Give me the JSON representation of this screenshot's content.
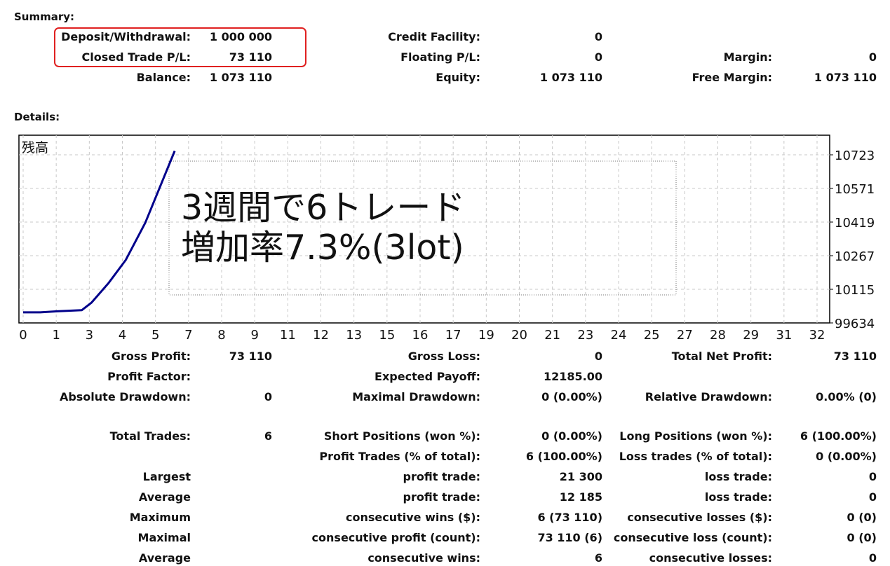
{
  "summary": {
    "heading": "Summary:",
    "deposit_label": "Deposit/Withdrawal:",
    "deposit_value": "1 000 000",
    "closed_pl_label": "Closed Trade P/L:",
    "closed_pl_value": "73 110",
    "balance_label": "Balance:",
    "balance_value": "1 073 110",
    "credit_label": "Credit Facility:",
    "credit_value": "0",
    "floating_label": "Floating P/L:",
    "floating_value": "0",
    "equity_label": "Equity:",
    "equity_value": "1 073 110",
    "margin_label": "Margin:",
    "margin_value": "0",
    "free_margin_label": "Free Margin:",
    "free_margin_value": "1 073 110"
  },
  "details": {
    "heading": "Details:"
  },
  "chart_data": {
    "type": "line",
    "title": "残高",
    "x": [
      0,
      0.7,
      1.4,
      2.4,
      2.8,
      3.5,
      4.2,
      5.0,
      6.2
    ],
    "y": [
      9970,
      9970,
      9975,
      9980,
      10015,
      10105,
      10210,
      10380,
      10708
    ],
    "x_ticks": [
      "0",
      "1",
      "3",
      "4",
      "5",
      "7",
      "8",
      "9",
      "11",
      "12",
      "13",
      "15",
      "16",
      "17",
      "19",
      "20",
      "21",
      "23",
      "24",
      "25",
      "27",
      "28",
      "29",
      "31",
      "32"
    ],
    "y_ticks": [
      "10723",
      "10571",
      "10419",
      "10267",
      "10115",
      "99634"
    ],
    "ylim": [
      9963.4,
      10780
    ],
    "xlim": [
      0,
      33
    ],
    "grid": true,
    "line_color": "#00008b",
    "annotation_line1": "3週間で6トレード",
    "annotation_line2": "増加率7.3%(3lot)"
  },
  "stats": {
    "gross_profit_label": "Gross Profit:",
    "gross_profit_value": "73 110",
    "gross_loss_label": "Gross Loss:",
    "gross_loss_value": "0",
    "total_net_label": "Total Net Profit:",
    "total_net_value": "73 110",
    "profit_factor_label": "Profit Factor:",
    "profit_factor_value": "",
    "expected_payoff_label": "Expected Payoff:",
    "expected_payoff_value": "12185.00",
    "abs_dd_label": "Absolute Drawdown:",
    "abs_dd_value": "0",
    "max_dd_label": "Maximal Drawdown:",
    "max_dd_value": "0 (0.00%)",
    "rel_dd_label": "Relative Drawdown:",
    "rel_dd_value": "0.00% (0)",
    "total_trades_label": "Total Trades:",
    "total_trades_value": "6",
    "short_pos_label": "Short Positions (won %):",
    "short_pos_value": "0 (0.00%)",
    "long_pos_label": "Long Positions (won %):",
    "long_pos_value": "6 (100.00%)",
    "profit_trades_label": "Profit Trades (% of total):",
    "profit_trades_value": "6 (100.00%)",
    "loss_trades_label": "Loss trades (% of total):",
    "loss_trades_value": "0 (0.00%)",
    "largest_label": "Largest",
    "largest_profit_label": "profit trade:",
    "largest_profit_value": "21 300",
    "largest_loss_label": "loss trade:",
    "largest_loss_value": "0",
    "average_label": "Average",
    "average_profit_label": "profit trade:",
    "average_profit_value": "12 185",
    "average_loss_label": "loss trade:",
    "average_loss_value": "0",
    "maximum_label": "Maximum",
    "max_cons_wins_label": "consecutive wins ($):",
    "max_cons_wins_value": "6 (73 110)",
    "max_cons_losses_label": "consecutive losses ($):",
    "max_cons_losses_value": "0 (0)",
    "maximal_label": "Maximal",
    "maximal_cons_profit_label": "consecutive profit (count):",
    "maximal_cons_profit_value": "73 110 (6)",
    "maximal_cons_loss_label": "consecutive loss (count):",
    "maximal_cons_loss_value": "0 (0)",
    "average2_label": "Average",
    "avg_cons_wins_label": "consecutive wins:",
    "avg_cons_wins_value": "6",
    "avg_cons_losses_label": "consecutive losses:",
    "avg_cons_losses_value": "0"
  }
}
